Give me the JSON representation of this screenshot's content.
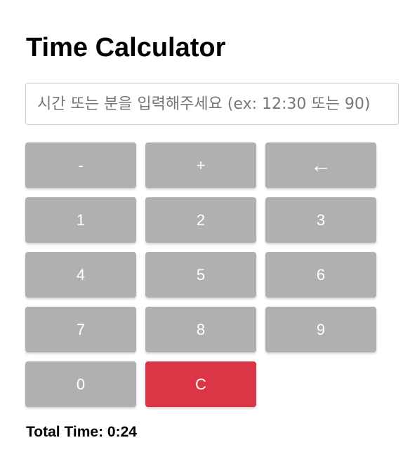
{
  "header": {
    "title": "Time Calculator"
  },
  "input": {
    "value": "",
    "placeholder": "시간 또는 분을 입력해주세요 (ex: 12:30 또는 90)"
  },
  "keypad": {
    "minus": "-",
    "plus": "+",
    "backspace": "←",
    "digits": [
      "1",
      "2",
      "3",
      "4",
      "5",
      "6",
      "7",
      "8",
      "9",
      "0"
    ],
    "clear": "C"
  },
  "result": {
    "label": "Total Time:",
    "value": "0:24"
  },
  "colors": {
    "key_bg": "#b0b0b0",
    "clear_bg": "#dc3545",
    "key_text": "#ffffff"
  },
  "icons": {
    "backspace": "left-arrow-icon"
  }
}
